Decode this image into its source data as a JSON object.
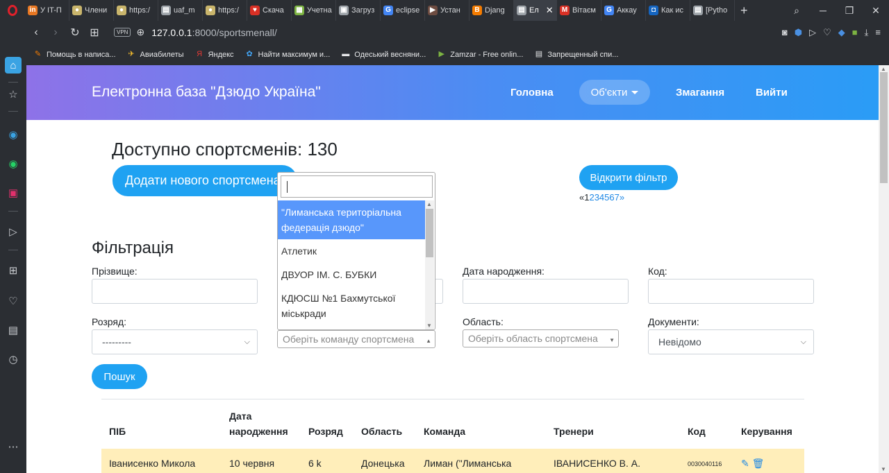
{
  "browser": {
    "tabs": [
      {
        "label": "У IT-П",
        "color": "#e87722",
        "glyph": "in"
      },
      {
        "label": "Члени",
        "color": "#c9b56c",
        "glyph": "●"
      },
      {
        "label": "https:/",
        "color": "#c9b56c",
        "glyph": "●"
      },
      {
        "label": "uaf_m",
        "color": "#9aa0a6",
        "glyph": "▤"
      },
      {
        "label": "https:/",
        "color": "#c9b56c",
        "glyph": "●"
      },
      {
        "label": "Скача",
        "color": "#d93025",
        "glyph": "♥"
      },
      {
        "label": "Учетна",
        "color": "#7cb342",
        "glyph": "▦"
      },
      {
        "label": "Загруз",
        "color": "#9aa0a6",
        "glyph": "▣"
      },
      {
        "label": "eclipse",
        "color": "#4285f4",
        "glyph": "G"
      },
      {
        "label": "Устан",
        "color": "#6d4c41",
        "glyph": "▶"
      },
      {
        "label": "Djang",
        "color": "#f57c00",
        "glyph": "B"
      },
      {
        "label": "Ел",
        "color": "#9aa0a6",
        "glyph": "▤"
      },
      {
        "label": "Вітаєм",
        "color": "#d93025",
        "glyph": "M"
      },
      {
        "label": "Аккау",
        "color": "#4285f4",
        "glyph": "G"
      },
      {
        "label": "Как ис",
        "color": "#1565c0",
        "glyph": "◘"
      },
      {
        "label": "[Pytho",
        "color": "#9aa0a6",
        "glyph": "▤"
      }
    ],
    "active_tab_index": 11,
    "url_host": "127.0.0.1",
    "url_path": ":8000/sportsmenall/",
    "vpn_label": "VPN",
    "bookmarks": [
      {
        "label": "Помощь в написа...",
        "color": "#f57c00",
        "glyph": "✎"
      },
      {
        "label": "Авиабилеты",
        "color": "#fbc02d",
        "glyph": "✈"
      },
      {
        "label": "Яндекс",
        "color": "#e53935",
        "glyph": "Я"
      },
      {
        "label": "Найти максимум и...",
        "color": "#42a5f5",
        "glyph": "✿"
      },
      {
        "label": "Одеський весняни...",
        "color": "#e6e7e9",
        "glyph": "▬"
      },
      {
        "label": "Zamzar - Free onlin...",
        "color": "#7cb342",
        "glyph": "▶"
      },
      {
        "label": "Запрещенный спи...",
        "color": "#e6e7e9",
        "glyph": "▤"
      }
    ]
  },
  "navbar": {
    "brand": "Електронна база \"Дзюдо Україна\"",
    "home": "Головна",
    "objects": "Об'єкти",
    "competitions": "Змагання",
    "logout": "Вийти"
  },
  "main": {
    "count_title": "Доступно спортсменів: 130",
    "add_button": "Додати нового спортсмена",
    "filter_button": "Відкрити фільтр",
    "pager_prev": "«",
    "pager_current": "1",
    "pager_pages": "234567",
    "pager_next": "»"
  },
  "filter": {
    "title": "Фільтрація",
    "surname_label": "Прізвище:",
    "birth_label": "Дата народження:",
    "code_label": "Код:",
    "rank_label": "Розряд:",
    "rank_value": "---------",
    "region_label": "Область:",
    "region_placeholder": "Оберіть область спортсмена",
    "documents_label": "Документи:",
    "documents_value": "Невідомо",
    "team_placeholder": "Оберіть команду спортсмена",
    "search_button": "Пошук"
  },
  "team_dropdown": {
    "options": [
      "\"Лиманська територіальна федерація дзюдо\"",
      "Атлетик",
      "ДВУОР ІМ. С. БУБКИ",
      "КДЮСШ №1 Бахмутської міськради"
    ],
    "highlighted_index": 0
  },
  "table": {
    "headers": {
      "name": "ПІБ",
      "birth": "Дата народження",
      "rank": "Розряд",
      "region": "Область",
      "team": "Команда",
      "coaches": "Тренери",
      "code": "Код",
      "manage": "Керування"
    },
    "rows": [
      {
        "name": "Іванисенко Микола",
        "birth": "10 червня",
        "rank": "6 k",
        "region": "Донецька",
        "team": "Лиман (\"Лиманська",
        "coaches": "ІВАНИСЕНКО В. А.",
        "code": "0030040116"
      }
    ],
    "row_highlight_color": "#ffeeba"
  },
  "colors": {
    "accent": "#1fa2f2",
    "link": "#1e88e5",
    "navbar_start": "#8e72e8",
    "navbar_end": "#2a9cf6"
  }
}
